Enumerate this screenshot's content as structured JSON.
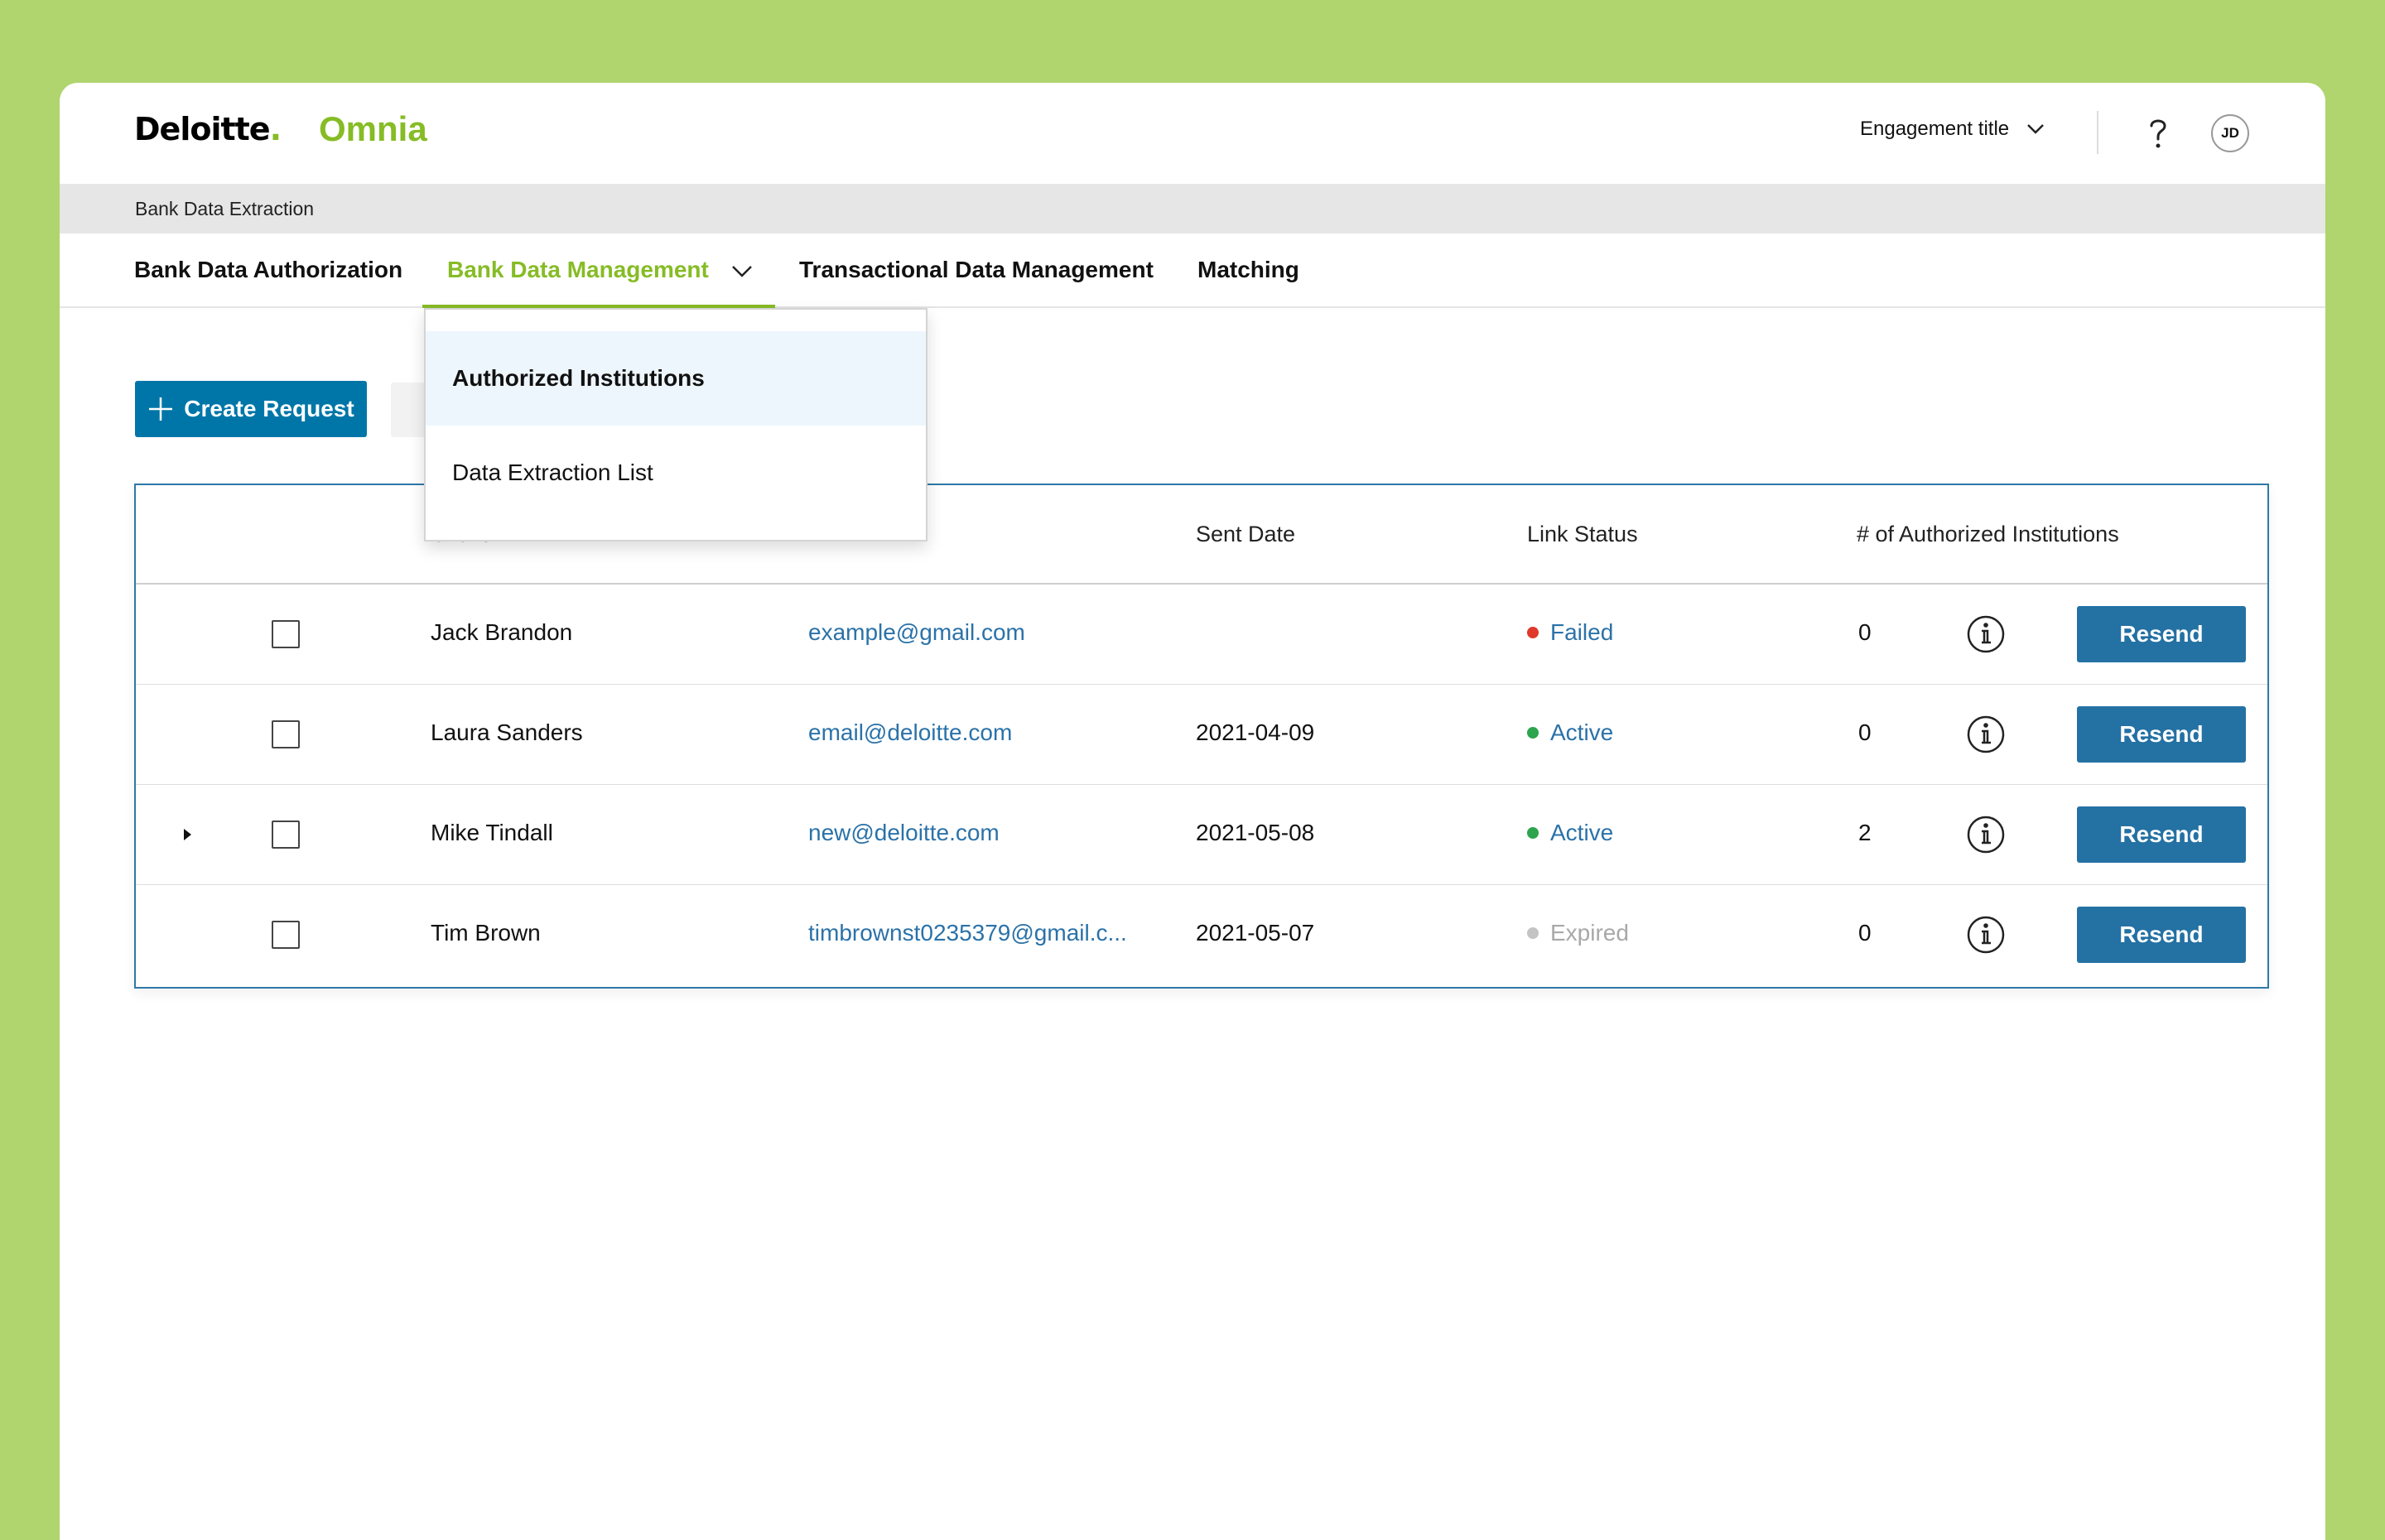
{
  "header": {
    "brand": "Deloitte",
    "brand_dot": ".",
    "product": "Omnia",
    "engagement_label": "Engagement title",
    "avatar_initials": "JD"
  },
  "breadcrumb": {
    "label": "Bank Data Extraction"
  },
  "nav": {
    "tabs": [
      {
        "label": "Bank Data Authorization"
      },
      {
        "label": "Bank Data Management"
      },
      {
        "label": "Transactional Data Management"
      },
      {
        "label": "Matching"
      }
    ]
  },
  "dropdown": {
    "items": [
      {
        "label": "Authorized Institutions"
      },
      {
        "label": "Data Extraction List"
      }
    ]
  },
  "toolbar": {
    "create_label": "Create Request"
  },
  "table": {
    "columns": [
      "Client",
      "Sent Date",
      "Link Status",
      "# of Authorized Institutions"
    ],
    "rows": [
      {
        "name": "Jack Brandon",
        "email": "example@gmail.com",
        "sent_date": "",
        "status": "Failed",
        "status_color": "#e0392b",
        "status_text_color": "#2b72a8",
        "count": "0",
        "action": "Resend"
      },
      {
        "name": "Laura Sanders",
        "email": "email@deloitte.com",
        "sent_date": "2021-04-09",
        "status": "Active",
        "status_color": "#2ea44f",
        "status_text_color": "#2b72a8",
        "count": "0",
        "action": "Resend"
      },
      {
        "name": "Mike Tindall",
        "email": "new@deloitte.com",
        "sent_date": "2021-05-08",
        "status": "Active",
        "status_color": "#2ea44f",
        "status_text_color": "#2b72a8",
        "count": "2",
        "action": "Resend"
      },
      {
        "name": "Tim Brown",
        "email": "timbrownst0235379@gmail.c...",
        "sent_date": "2021-05-07",
        "status": "Expired",
        "status_color": "#c4c4c4",
        "status_text_color": "#a8a8a8",
        "count": "0",
        "action": "Resend"
      }
    ]
  },
  "colors": {
    "brand_green": "#86bc25",
    "primary_blue": "#0076a8",
    "button_blue": "#2471a3",
    "page_bg": "#b0d46e"
  }
}
